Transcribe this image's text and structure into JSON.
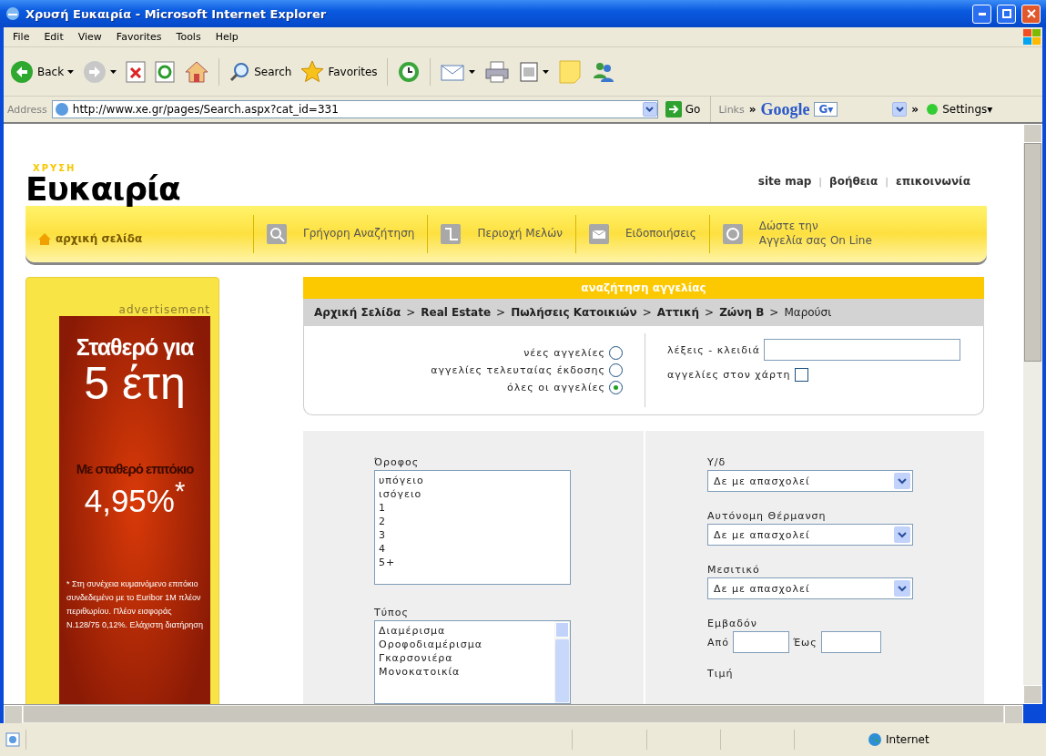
{
  "window": {
    "title": "Χρυσή Ευκαιρία - Microsoft Internet Explorer"
  },
  "menu": [
    "File",
    "Edit",
    "View",
    "Favorites",
    "Tools",
    "Help"
  ],
  "toolbar": [
    {
      "kind": "back",
      "label": "Back",
      "caret": true
    },
    {
      "kind": "forward",
      "caret": true
    },
    {
      "kind": "stop"
    },
    {
      "kind": "refresh"
    },
    {
      "kind": "home"
    },
    {
      "kind": "search",
      "label": "Search"
    },
    {
      "kind": "favorites",
      "label": "Favorites"
    },
    {
      "kind": "history"
    },
    {
      "kind": "mail",
      "caret": true
    },
    {
      "kind": "print"
    },
    {
      "kind": "word",
      "caret": true
    },
    {
      "kind": "note"
    },
    {
      "kind": "messenger"
    }
  ],
  "address_bar": {
    "label": "Address",
    "url": "http://www.xe.gr/pages/Search.aspx?cat_id=331",
    "go": "Go",
    "links": "Links",
    "chevron": "»",
    "google": "Google",
    "google_button": "G▾",
    "chevron_2": "»",
    "settings": "Settings▾"
  },
  "page": {
    "logo": {
      "small": "ΧΡΥΣΗ",
      "main": "Ευκαιρία"
    },
    "top_links": [
      "site map",
      "βοήθεια",
      "επικοινωνία"
    ],
    "top_links_separator": "|",
    "home_link": "αρχική σελίδα",
    "nav": [
      {
        "kind": "search",
        "label": "Γρήγορη  Αναζήτηση"
      },
      {
        "kind": "members",
        "label": "Περιοχή Μελών"
      },
      {
        "kind": "mail",
        "label": "Ειδοποιήσεις"
      },
      {
        "kind": "at",
        "label": "Δώστε την\nΑγγελία σας On Line"
      }
    ],
    "ad": {
      "caption": "advertisement",
      "headline": "Σταθερό για",
      "years": "5 έτη",
      "rate_label": "Με σταθερό επιτόκιο",
      "rate": "4,95%$^{*}$",
      "footnote": "* Στη συνέχεια κυμαινόμενο επιτόκιο συνδεδεμένο με το Euribor 1M πλέον περιθωρίου. Πλέον εισφοράς Ν.128/75 0,12%. Ελάχιστη διατήρηση"
    },
    "search": {
      "title": "αναζήτηση αγγελίας",
      "breadcrumb_separator": ">",
      "breadcrumb": [
        {
          "label": "Αρχική Σελίδα",
          "current": false
        },
        {
          "label": "Real Estate",
          "current": false
        },
        {
          "label": "Πωλήσεις Κατοικιών",
          "current": false
        },
        {
          "label": "Αττική",
          "current": false
        },
        {
          "label": "Ζώνη Β",
          "current": false
        },
        {
          "label": "Μαρούσι",
          "current": true
        }
      ],
      "scope": [
        {
          "label": "νέες αγγελίες",
          "selected": false
        },
        {
          "label": "αγγελίες τελευταίας έκδοσης",
          "selected": false
        },
        {
          "label": "όλες οι αγγελίες",
          "selected": true
        }
      ],
      "keywords": {
        "label": "λέξεις - κλειδιά"
      },
      "map": {
        "label": "αγγελίες στον χάρτη",
        "checked": false
      },
      "lists": [
        {
          "label": "Όροφος",
          "scrollbar": false,
          "options": [
            "υπόγειο",
            "ισόγειο",
            "1",
            "2",
            "3",
            "4",
            "5+"
          ]
        },
        {
          "label": "Τύπος",
          "scrollbar": true,
          "options": [
            "Διαμέρισμα",
            "Οροφοδιαμέρισμα",
            "Γκαρσονιέρα",
            "Μονοκατοικία"
          ]
        }
      ],
      "selects": [
        {
          "label": "Υ/δ",
          "value": "Δε με απασχολεί"
        },
        {
          "label": "Αυτόνομη Θέρμανση",
          "value": "Δε με απασχολεί"
        },
        {
          "label": "Μεσιτικό",
          "value": "Δε με απασχολεί"
        }
      ],
      "area": {
        "label": "Εμβαδόν",
        "from": "Από",
        "to": "Έως"
      },
      "price": {
        "label": "Τιμή"
      }
    }
  },
  "status_bar": {
    "zone": "Internet"
  }
}
